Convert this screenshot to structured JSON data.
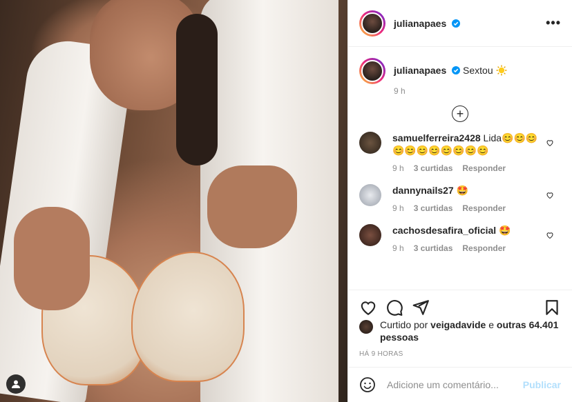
{
  "post": {
    "username": "julianapaes",
    "caption": "Sextou",
    "caption_emoji": "sun-emoji",
    "caption_time": "9 h"
  },
  "comments": [
    {
      "username": "samuelferreira2428",
      "text": "Lida😊😊😊😊😊😊😊😊😊😊😊",
      "time": "9 h",
      "likes": "3 curtidas",
      "reply": "Responder",
      "avatar_color": "#3a2d20"
    },
    {
      "username": "dannynails27",
      "text": "🤩",
      "time": "9 h",
      "likes": "3 curtidas",
      "reply": "Responder",
      "avatar_color": "#c9ccd2"
    },
    {
      "username": "cachosdesafira_oficial",
      "text": "🤩",
      "time": "9 h",
      "likes": "3 curtidas",
      "reply": "Responder",
      "avatar_color": "#4a2f26"
    }
  ],
  "likes": {
    "prefix": "Curtido por",
    "liked_by": "veigadavide",
    "and": "e",
    "others": "outras 64.401 pessoas"
  },
  "timestamp": "HÁ 9 HORAS",
  "add_comment": {
    "placeholder": "Adicione um comentário...",
    "publish": "Publicar"
  },
  "colors": {
    "verified": "#0095f6",
    "publish_disabled": "#b2dffc",
    "muted_text": "#8e8e8e"
  },
  "icons": [
    "more-icon",
    "verified-icon",
    "plus-circle-icon",
    "heart-icon",
    "comment-icon",
    "share-icon",
    "save-icon",
    "emoji-icon",
    "user-tag-icon"
  ]
}
